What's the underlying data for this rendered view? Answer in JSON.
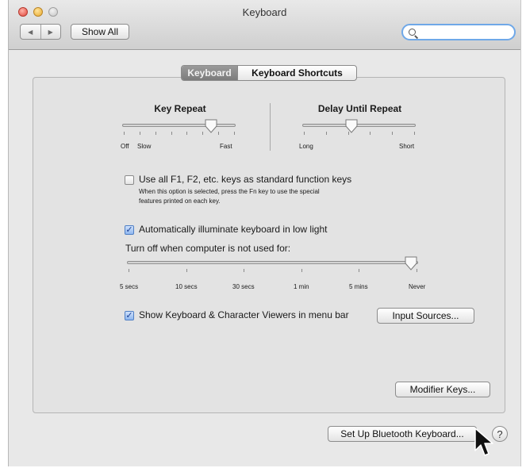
{
  "window": {
    "title": "Keyboard"
  },
  "toolbar": {
    "back_glyph": "◀",
    "forward_glyph": "▶",
    "show_all_label": "Show All",
    "search_placeholder": "",
    "search_icon": "search-icon"
  },
  "tabs": [
    {
      "label": "Keyboard",
      "selected": true
    },
    {
      "label": "Keyboard Shortcuts",
      "selected": false
    }
  ],
  "key_repeat": {
    "title": "Key Repeat",
    "labels": {
      "off": "Off",
      "slow": "Slow",
      "fast": "Fast"
    },
    "level": 0.82
  },
  "delay_until_repeat": {
    "title": "Delay Until Repeat",
    "labels": {
      "long": "Long",
      "short": "Short"
    },
    "level": 0.42
  },
  "function_keys": {
    "checked": false,
    "label": "Use all F1, F2, etc. keys as standard function keys",
    "description_line1": "When this option is selected, press the Fn key to use the special",
    "description_line2": "features printed on each key."
  },
  "illuminate": {
    "checked": true,
    "label": "Automatically illuminate keyboard in low light",
    "turn_off_label": "Turn off when computer is not used for:",
    "options": [
      "5 secs",
      "10 secs",
      "30 secs",
      "1 min",
      "5 mins",
      "Never"
    ],
    "selected": "Never"
  },
  "viewers": {
    "checked": true,
    "label": "Show Keyboard & Character Viewers in menu bar"
  },
  "buttons": {
    "input_sources": "Input Sources...",
    "modifier_keys": "Modifier Keys...",
    "bluetooth": "Set Up Bluetooth Keyboard...",
    "help": "?"
  },
  "colors": {
    "accent": "#6fa8e8",
    "check": "#1b3f93"
  }
}
